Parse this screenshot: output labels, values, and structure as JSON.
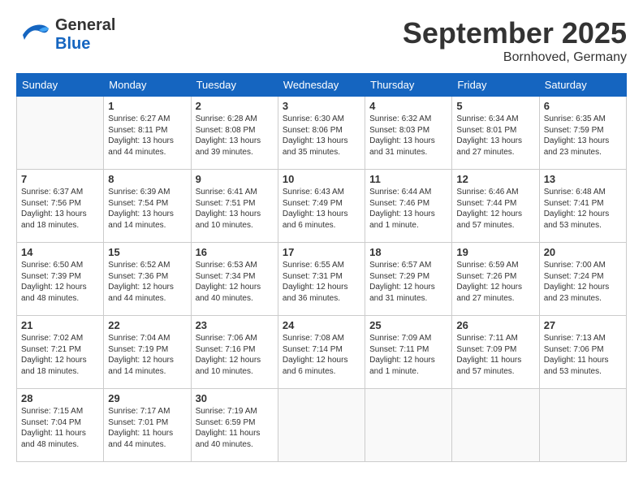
{
  "header": {
    "logo_line1": "General",
    "logo_line2": "Blue",
    "month": "September 2025",
    "location": "Bornhoved, Germany"
  },
  "weekdays": [
    "Sunday",
    "Monday",
    "Tuesday",
    "Wednesday",
    "Thursday",
    "Friday",
    "Saturday"
  ],
  "weeks": [
    [
      {
        "day": "",
        "info": ""
      },
      {
        "day": "1",
        "info": "Sunrise: 6:27 AM\nSunset: 8:11 PM\nDaylight: 13 hours\nand 44 minutes."
      },
      {
        "day": "2",
        "info": "Sunrise: 6:28 AM\nSunset: 8:08 PM\nDaylight: 13 hours\nand 39 minutes."
      },
      {
        "day": "3",
        "info": "Sunrise: 6:30 AM\nSunset: 8:06 PM\nDaylight: 13 hours\nand 35 minutes."
      },
      {
        "day": "4",
        "info": "Sunrise: 6:32 AM\nSunset: 8:03 PM\nDaylight: 13 hours\nand 31 minutes."
      },
      {
        "day": "5",
        "info": "Sunrise: 6:34 AM\nSunset: 8:01 PM\nDaylight: 13 hours\nand 27 minutes."
      },
      {
        "day": "6",
        "info": "Sunrise: 6:35 AM\nSunset: 7:59 PM\nDaylight: 13 hours\nand 23 minutes."
      }
    ],
    [
      {
        "day": "7",
        "info": "Sunrise: 6:37 AM\nSunset: 7:56 PM\nDaylight: 13 hours\nand 18 minutes."
      },
      {
        "day": "8",
        "info": "Sunrise: 6:39 AM\nSunset: 7:54 PM\nDaylight: 13 hours\nand 14 minutes."
      },
      {
        "day": "9",
        "info": "Sunrise: 6:41 AM\nSunset: 7:51 PM\nDaylight: 13 hours\nand 10 minutes."
      },
      {
        "day": "10",
        "info": "Sunrise: 6:43 AM\nSunset: 7:49 PM\nDaylight: 13 hours\nand 6 minutes."
      },
      {
        "day": "11",
        "info": "Sunrise: 6:44 AM\nSunset: 7:46 PM\nDaylight: 13 hours\nand 1 minute."
      },
      {
        "day": "12",
        "info": "Sunrise: 6:46 AM\nSunset: 7:44 PM\nDaylight: 12 hours\nand 57 minutes."
      },
      {
        "day": "13",
        "info": "Sunrise: 6:48 AM\nSunset: 7:41 PM\nDaylight: 12 hours\nand 53 minutes."
      }
    ],
    [
      {
        "day": "14",
        "info": "Sunrise: 6:50 AM\nSunset: 7:39 PM\nDaylight: 12 hours\nand 48 minutes."
      },
      {
        "day": "15",
        "info": "Sunrise: 6:52 AM\nSunset: 7:36 PM\nDaylight: 12 hours\nand 44 minutes."
      },
      {
        "day": "16",
        "info": "Sunrise: 6:53 AM\nSunset: 7:34 PM\nDaylight: 12 hours\nand 40 minutes."
      },
      {
        "day": "17",
        "info": "Sunrise: 6:55 AM\nSunset: 7:31 PM\nDaylight: 12 hours\nand 36 minutes."
      },
      {
        "day": "18",
        "info": "Sunrise: 6:57 AM\nSunset: 7:29 PM\nDaylight: 12 hours\nand 31 minutes."
      },
      {
        "day": "19",
        "info": "Sunrise: 6:59 AM\nSunset: 7:26 PM\nDaylight: 12 hours\nand 27 minutes."
      },
      {
        "day": "20",
        "info": "Sunrise: 7:00 AM\nSunset: 7:24 PM\nDaylight: 12 hours\nand 23 minutes."
      }
    ],
    [
      {
        "day": "21",
        "info": "Sunrise: 7:02 AM\nSunset: 7:21 PM\nDaylight: 12 hours\nand 18 minutes."
      },
      {
        "day": "22",
        "info": "Sunrise: 7:04 AM\nSunset: 7:19 PM\nDaylight: 12 hours\nand 14 minutes."
      },
      {
        "day": "23",
        "info": "Sunrise: 7:06 AM\nSunset: 7:16 PM\nDaylight: 12 hours\nand 10 minutes."
      },
      {
        "day": "24",
        "info": "Sunrise: 7:08 AM\nSunset: 7:14 PM\nDaylight: 12 hours\nand 6 minutes."
      },
      {
        "day": "25",
        "info": "Sunrise: 7:09 AM\nSunset: 7:11 PM\nDaylight: 12 hours\nand 1 minute."
      },
      {
        "day": "26",
        "info": "Sunrise: 7:11 AM\nSunset: 7:09 PM\nDaylight: 11 hours\nand 57 minutes."
      },
      {
        "day": "27",
        "info": "Sunrise: 7:13 AM\nSunset: 7:06 PM\nDaylight: 11 hours\nand 53 minutes."
      }
    ],
    [
      {
        "day": "28",
        "info": "Sunrise: 7:15 AM\nSunset: 7:04 PM\nDaylight: 11 hours\nand 48 minutes."
      },
      {
        "day": "29",
        "info": "Sunrise: 7:17 AM\nSunset: 7:01 PM\nDaylight: 11 hours\nand 44 minutes."
      },
      {
        "day": "30",
        "info": "Sunrise: 7:19 AM\nSunset: 6:59 PM\nDaylight: 11 hours\nand 40 minutes."
      },
      {
        "day": "",
        "info": ""
      },
      {
        "day": "",
        "info": ""
      },
      {
        "day": "",
        "info": ""
      },
      {
        "day": "",
        "info": ""
      }
    ]
  ]
}
